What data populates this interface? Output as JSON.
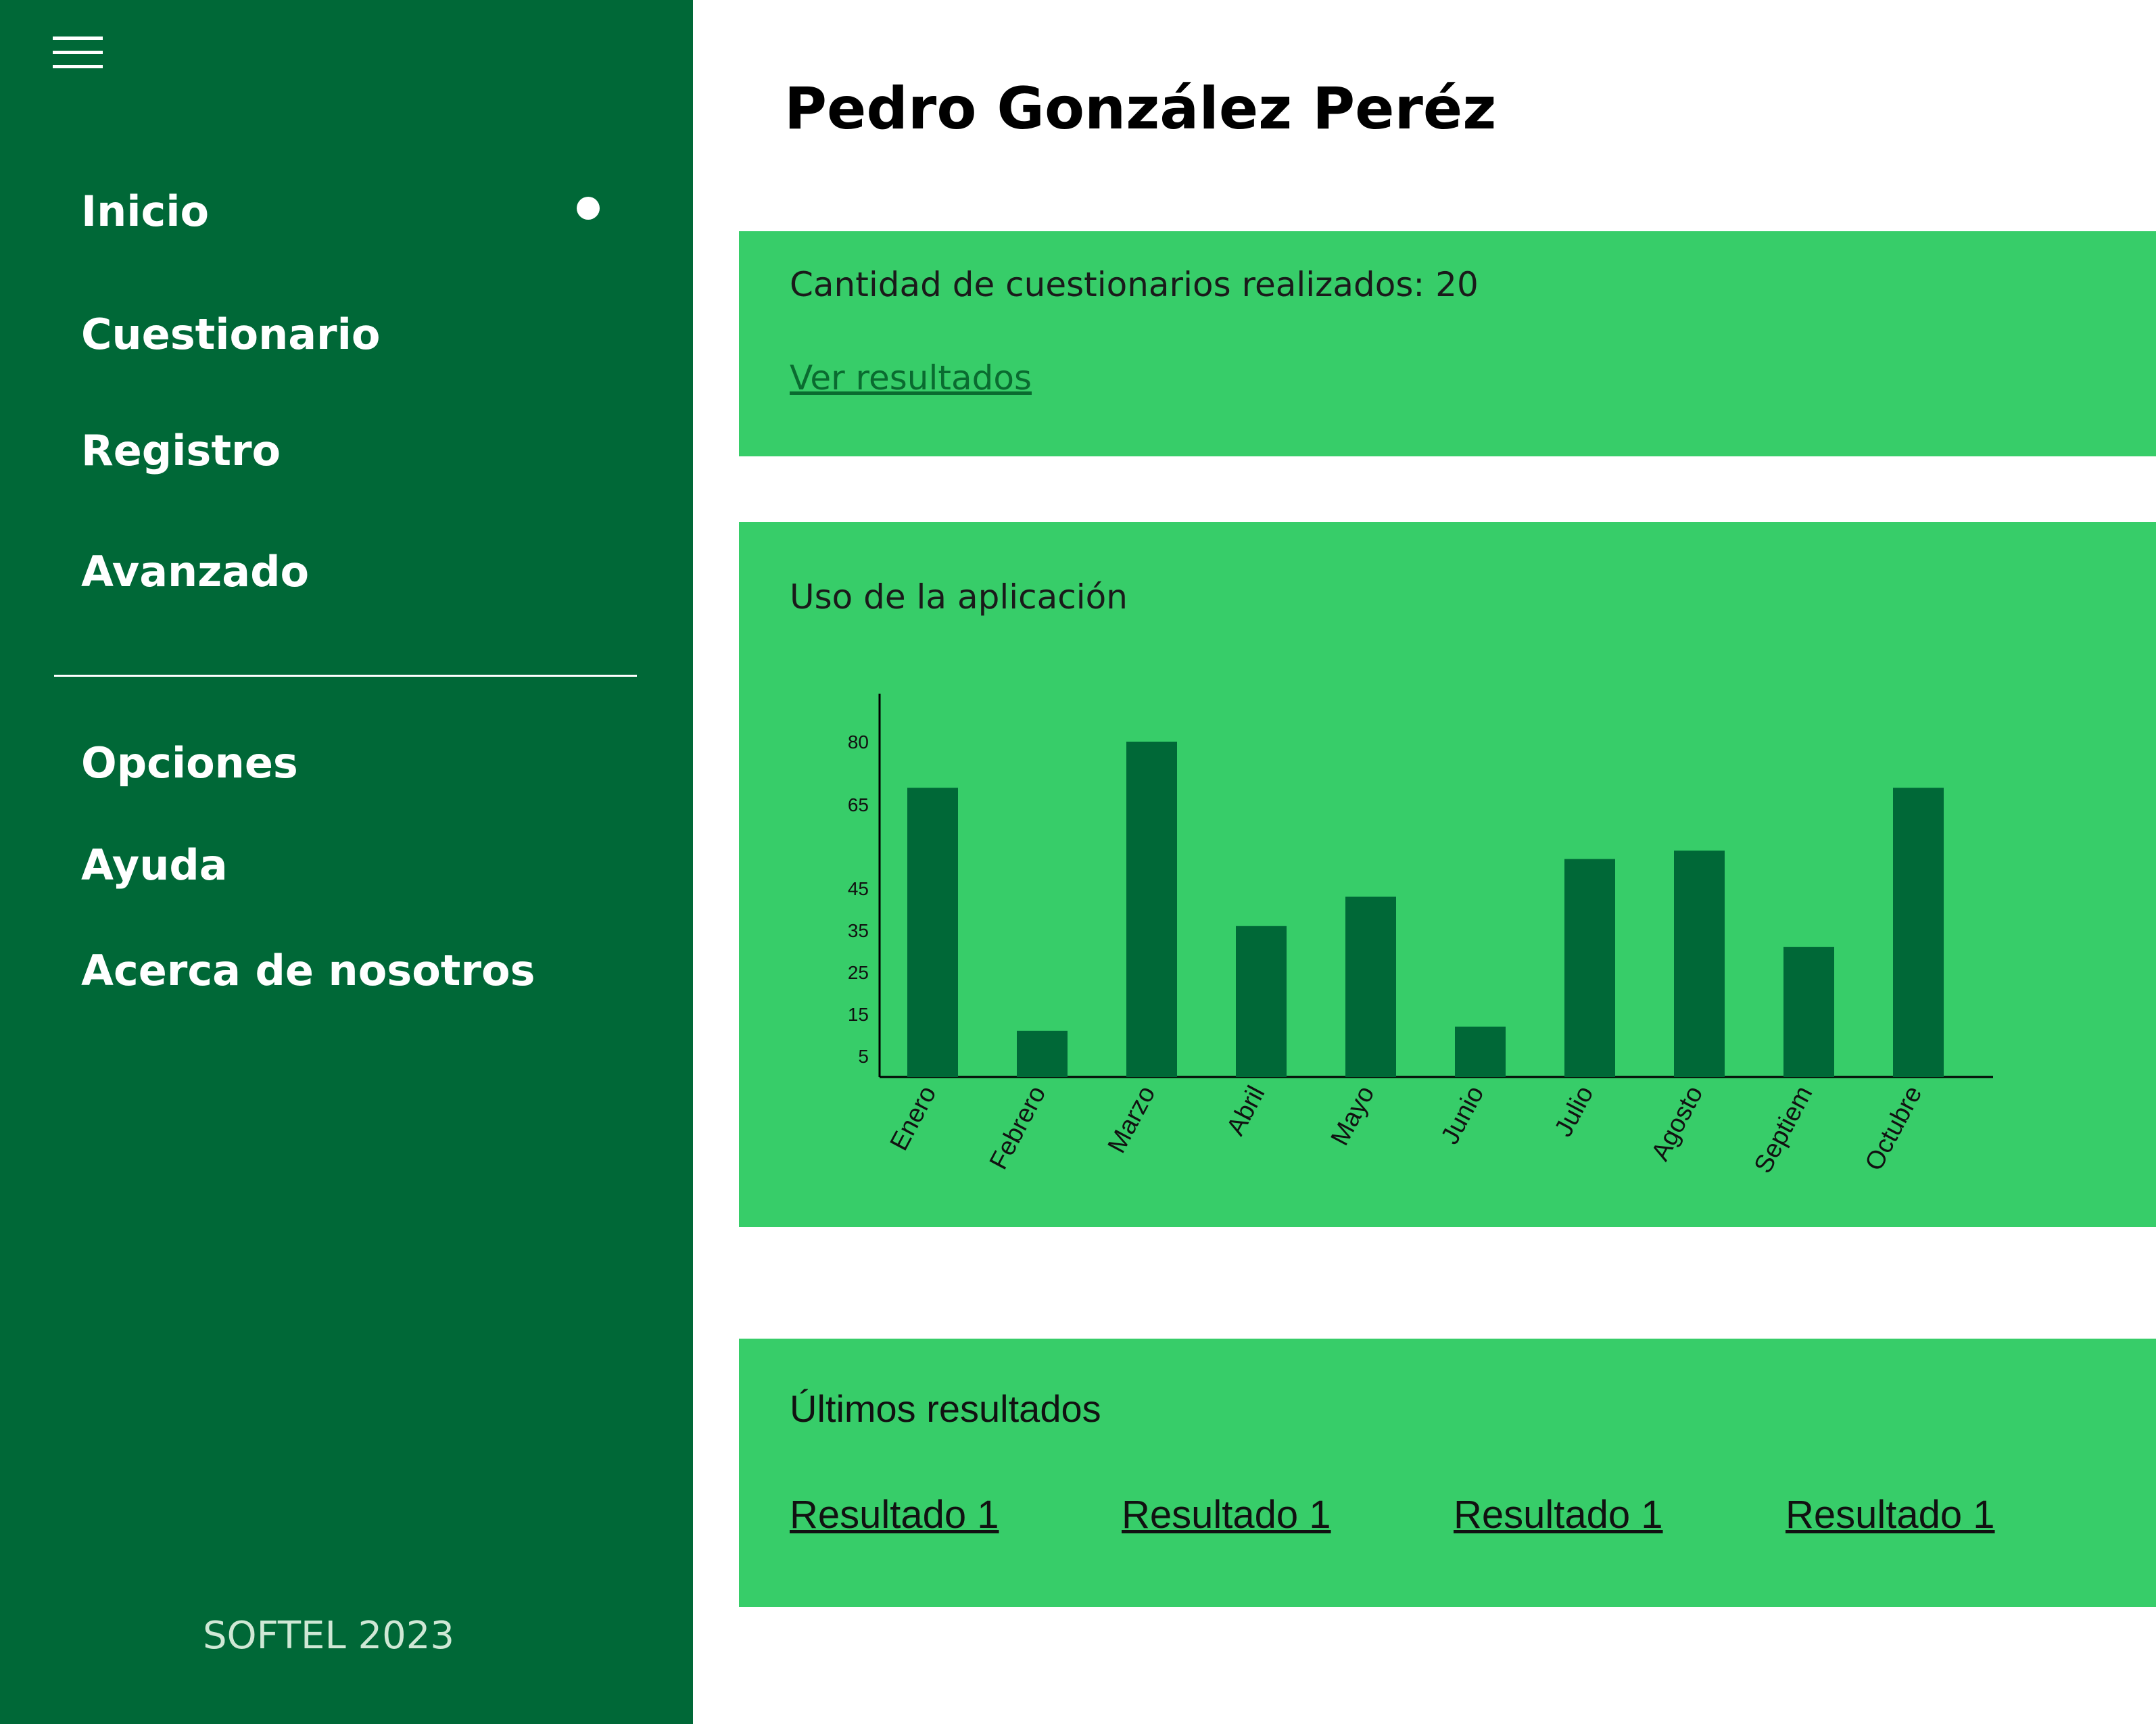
{
  "sidebar": {
    "menu_icon": "hamburger-menu-icon",
    "nav_primary": [
      {
        "label": "Inicio",
        "active": true
      },
      {
        "label": "Cuestionario",
        "active": false
      },
      {
        "label": "Registro",
        "active": false
      },
      {
        "label": "Avanzado",
        "active": false
      }
    ],
    "nav_secondary": [
      {
        "label": "Opciones"
      },
      {
        "label": "Ayuda"
      },
      {
        "label": "Acerca de nosotros"
      }
    ],
    "footer": "SOFTEL 2023"
  },
  "header": {
    "title": "Pedro González Peréz"
  },
  "summary_card": {
    "count_text": "Cantidad de cuestionarios realizados: 20",
    "link_label": "Ver resultados"
  },
  "usage_card": {
    "title": "Uso de la aplicación"
  },
  "chart_data": {
    "type": "bar",
    "title": "Uso de la aplicación",
    "categories": [
      "Enero",
      "Febrero",
      "Marzo",
      "Abril",
      "Mayo",
      "Junio",
      "Julio",
      "Agosto",
      "Septiem",
      "Octubre"
    ],
    "values": [
      69,
      11,
      80,
      36,
      43,
      12,
      52,
      54,
      31,
      69
    ],
    "y_ticks": [
      5,
      15,
      25,
      35,
      45,
      65,
      80
    ],
    "grid": false,
    "legend": "none"
  },
  "results_card": {
    "title": "Últimos resultados",
    "links": [
      "Resultado 1",
      "Resultado 1",
      "Resultado 1",
      "Resultado 1"
    ]
  },
  "colors": {
    "sidebar_bg": "#006837",
    "card_bg": "#37cd69",
    "bar_color": "#006837",
    "link_color": "#0a6b30"
  }
}
